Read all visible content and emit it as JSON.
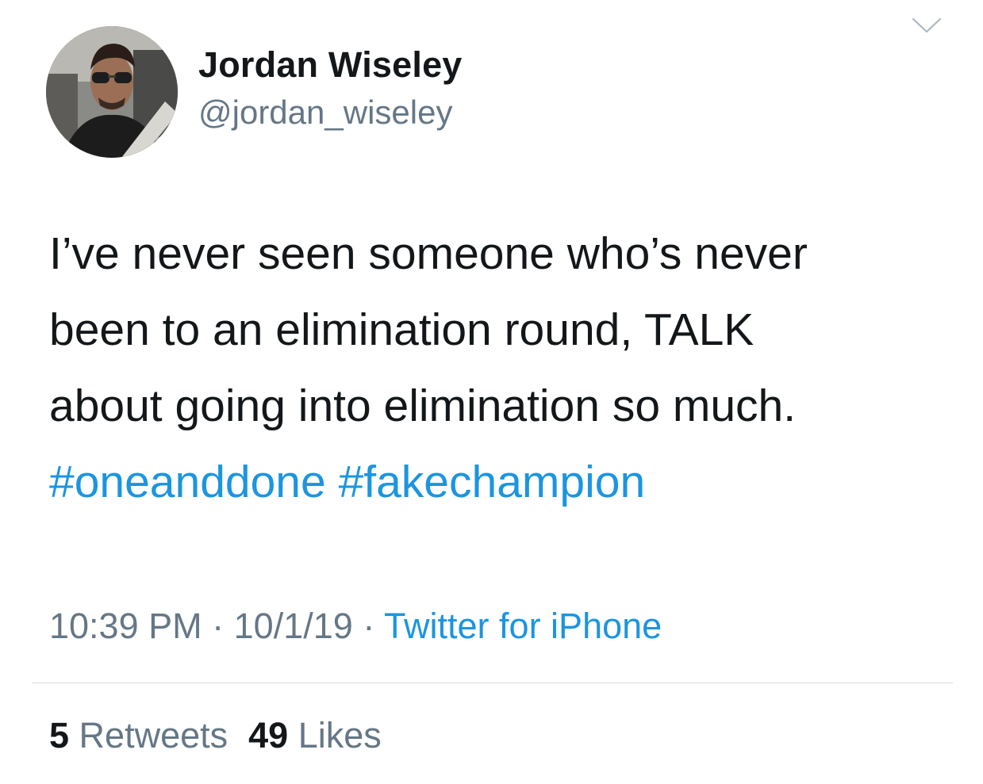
{
  "tweet": {
    "author": {
      "display_name": "Jordan Wiseley",
      "handle": "@jordan_wiseley"
    },
    "text_lines": [
      "I’ve never seen someone who’s never",
      "been to an elimination round, TALK",
      "about going into elimination so much."
    ],
    "hashtags": [
      "#oneanddone",
      "#fakechampion"
    ],
    "time": "10:39 PM",
    "date": "10/1/19",
    "separator": "·",
    "source": "Twitter for iPhone",
    "retweets": {
      "count": "5",
      "label": "Retweets"
    },
    "likes": {
      "count": "49",
      "label": "Likes"
    }
  },
  "icons": {
    "menu": "chevron-down-icon"
  },
  "colors": {
    "text": "#14171a",
    "secondary": "#657786",
    "link": "#1b95e0",
    "divider": "#d6dbdf"
  }
}
